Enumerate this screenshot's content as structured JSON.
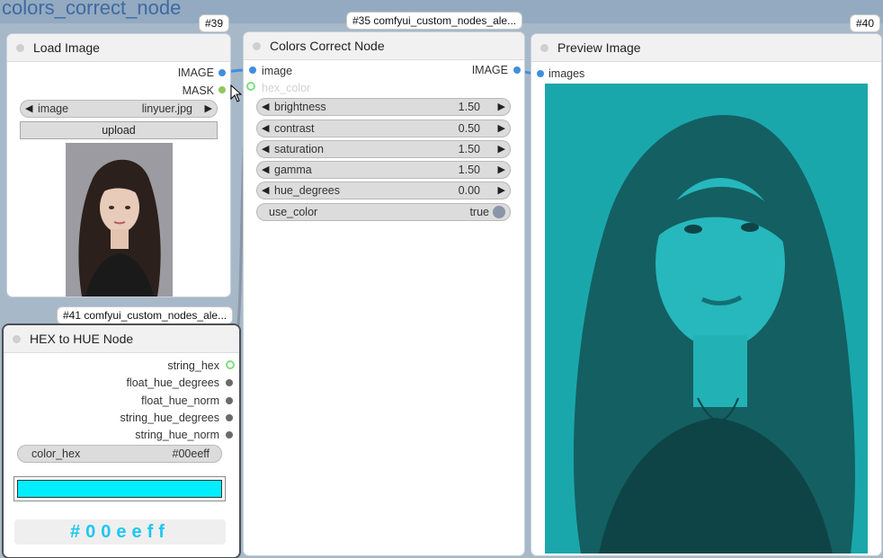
{
  "group": {
    "title": "colors_correct_node"
  },
  "nodes": {
    "load_image": {
      "id": "#39",
      "title": "Load Image",
      "outputs": [
        "IMAGE",
        "MASK"
      ],
      "image_widget": {
        "label": "image",
        "value": "linyuer.jpg"
      },
      "upload_label": "upload"
    },
    "colors_correct": {
      "id_badge": "#35 comfyui_custom_nodes_ale...",
      "title": "Colors Correct Node",
      "inputs": [
        "image",
        "hex_color"
      ],
      "output": "IMAGE",
      "widgets": [
        {
          "label": "brightness",
          "value": "1.50"
        },
        {
          "label": "contrast",
          "value": "0.50"
        },
        {
          "label": "saturation",
          "value": "1.50"
        },
        {
          "label": "gamma",
          "value": "1.50"
        },
        {
          "label": "hue_degrees",
          "value": "0.00"
        }
      ],
      "toggle": {
        "label": "use_color",
        "value": "true"
      }
    },
    "preview_image": {
      "id": "#40",
      "title": "Preview Image",
      "input": "images"
    },
    "hex_to_hue": {
      "id_badge": "#41 comfyui_custom_nodes_ale...",
      "title": "HEX to HUE Node",
      "outputs": [
        "string_hex",
        "float_hue_degrees",
        "float_hue_norm",
        "string_hue_degrees",
        "string_hue_norm"
      ],
      "color_widget": {
        "label": "color_hex",
        "value": "#00eeff"
      },
      "swatch_color": "#00eeff",
      "hex_display": "#00eeff"
    }
  },
  "colors": {
    "image_port": "#3f8fe0",
    "mask_port": "#8fc85a",
    "string_port": "#7ee07e",
    "other_port": "#6a6a6a",
    "preview_tint": "#1aa7ab"
  }
}
